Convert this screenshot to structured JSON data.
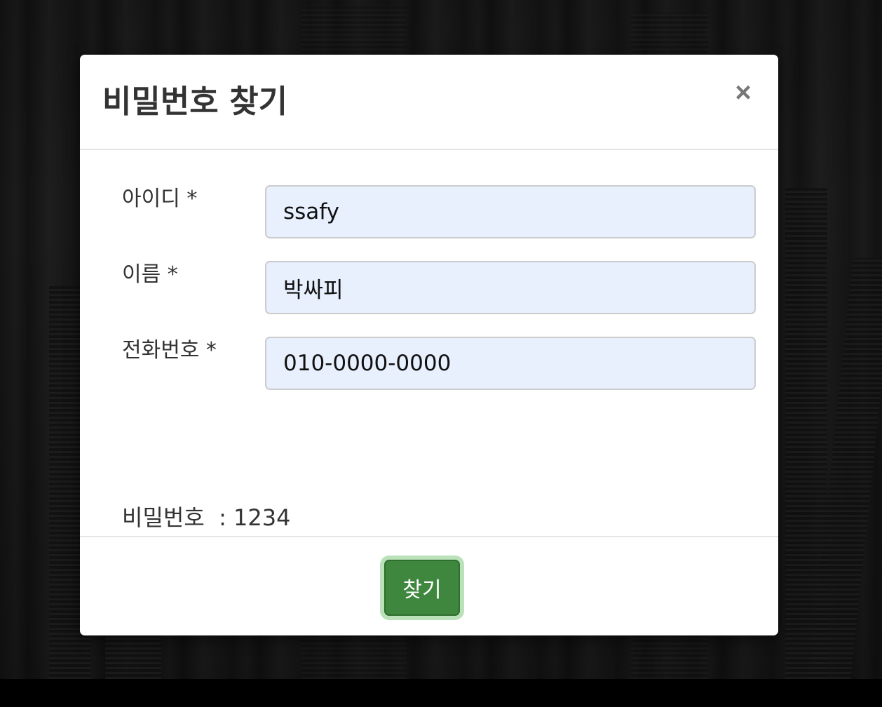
{
  "modal": {
    "title": "비밀번호 찾기",
    "close_label": "×"
  },
  "form": {
    "fields": [
      {
        "label": "아이디 *",
        "value": "ssafy"
      },
      {
        "label": "이름 *",
        "value": "박싸피"
      },
      {
        "label": "전화번호 *",
        "value": "010-0000-0000"
      }
    ],
    "result_text": "비밀번호  : 1234"
  },
  "footer": {
    "find_label": "찾기"
  },
  "colors": {
    "input_background": "#e8f0fe",
    "button_primary": "#3f873f",
    "button_focus_ring": "#82c882"
  }
}
